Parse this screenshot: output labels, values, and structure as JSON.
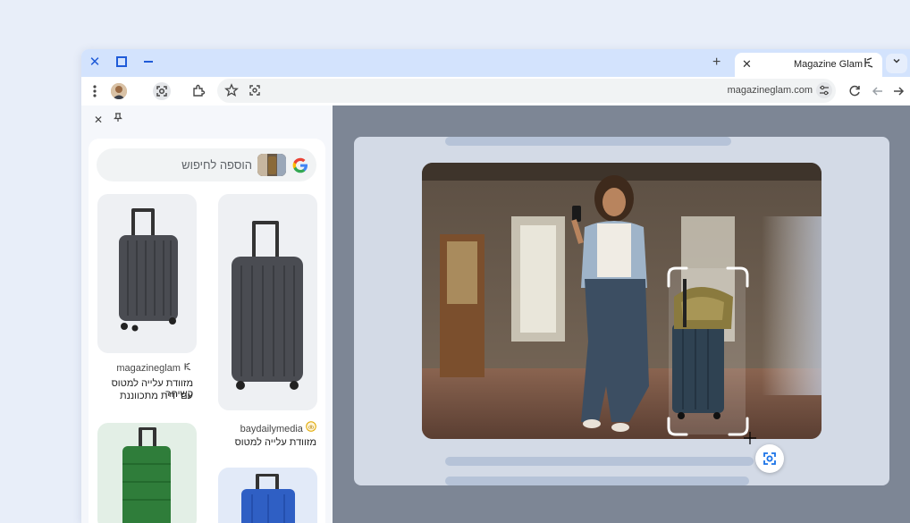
{
  "tab": {
    "title": "Magazine Glam"
  },
  "address": {
    "url": "magazineglam.com"
  },
  "side_panel": {
    "search_placeholder": "הוספה לחיפוש",
    "results": [
      {
        "source": "magazineglam",
        "label_line1": "מזוודת עלייה למטוס קשיחה",
        "label_line2": "עם ידית מתכווננת"
      },
      {
        "source": "baydailymedia",
        "label_line1": "מזוודת עלייה למטוס",
        "label_line2": ""
      }
    ]
  },
  "colors": {
    "tab_strip": "#d3e3fd",
    "window_controls": "#1f5bd8",
    "page_bg": "#e8eef9"
  },
  "icons": [
    "close-icon",
    "maximize-icon",
    "minimize-icon",
    "plus-icon",
    "chevron-down-icon",
    "kebab-menu-icon",
    "lens-icon",
    "extensions-icon",
    "star-icon",
    "tune-icon",
    "reload-icon",
    "back-arrow-icon",
    "forward-arrow-icon",
    "pin-icon",
    "google-icon"
  ]
}
